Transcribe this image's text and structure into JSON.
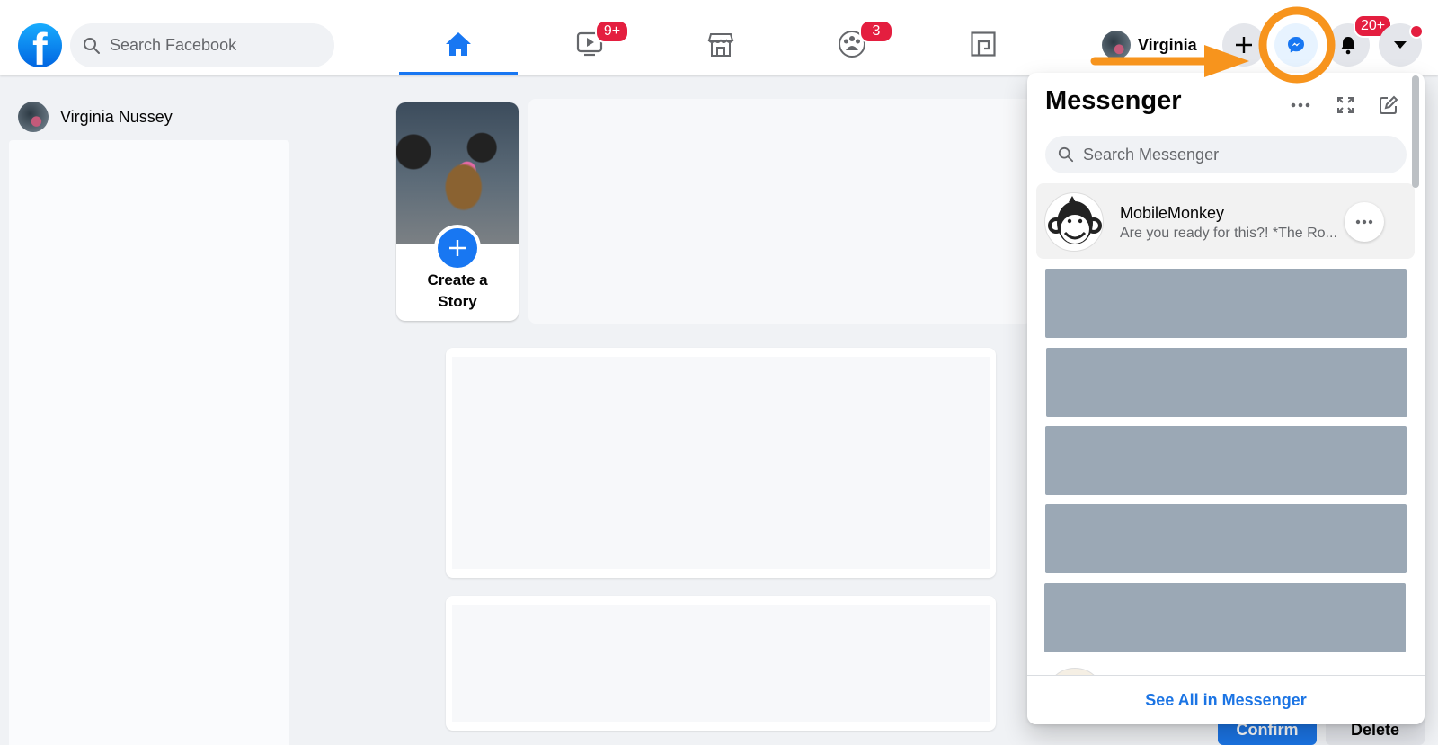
{
  "topbar": {
    "search_placeholder": "Search Facebook",
    "nav_tabs": [
      {
        "name": "home",
        "icon": "home-icon",
        "active": true,
        "badge": null
      },
      {
        "name": "watch",
        "icon": "video-icon",
        "active": false,
        "badge": "9+"
      },
      {
        "name": "marketplace",
        "icon": "marketplace-icon",
        "active": false,
        "badge": null
      },
      {
        "name": "groups",
        "icon": "groups-icon",
        "active": false,
        "badge": "3"
      },
      {
        "name": "gaming",
        "icon": "gaming-icon",
        "active": false,
        "badge": null
      }
    ],
    "profile_name": "Virginia",
    "create_icon": "plus-icon",
    "messenger_icon": "messenger-icon",
    "notifications_badge": "20+",
    "notifications_icon": "bell-icon",
    "account_icon": "caret-down-icon"
  },
  "left": {
    "user_name": "Virginia Nussey"
  },
  "stories": {
    "create_label_line1": "Create a",
    "create_label_line2": "Story"
  },
  "requests": {
    "confirm_label": "Confirm",
    "delete_label": "Delete"
  },
  "messenger": {
    "title": "Messenger",
    "search_placeholder": "Search Messenger",
    "conversations": [
      {
        "name": "MobileMonkey",
        "preview": "Are you ready for this?! *The Ro..."
      }
    ],
    "redacted_rows": 5,
    "footer_link": "See All in Messenger"
  },
  "colors": {
    "brand_blue": "#1877f2",
    "badge_red": "#e41e3f",
    "annotation_orange": "#f7941d",
    "redacted_gray": "#9ba8b5"
  }
}
